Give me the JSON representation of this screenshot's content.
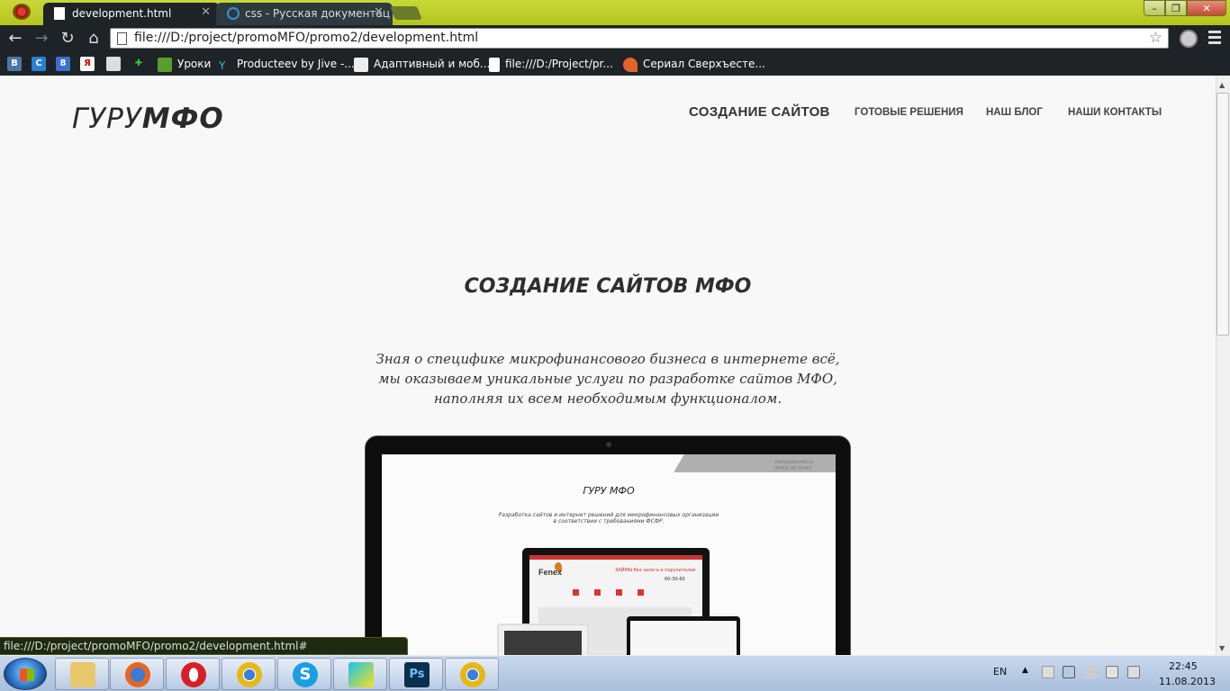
{
  "browser": {
    "tabs": [
      {
        "title": "development.html",
        "active": true
      },
      {
        "title": "css - Русская документац",
        "active": false
      }
    ],
    "address": "file:///D:/project/promoMFO/promo2/development.html",
    "bookmarks": [
      {
        "label": "Уроки",
        "icon": "3d-icon"
      },
      {
        "label": "Producteev by Jive -...",
        "icon": "producteev-icon"
      },
      {
        "label": "Адаптивный и моб...",
        "icon": "h-icon"
      },
      {
        "label": "file:///D:/Project/pr...",
        "icon": "file-icon"
      },
      {
        "label": "Сериал Сверхъесте...",
        "icon": "flame-icon"
      }
    ],
    "bookmark_shortcuts": [
      "В",
      "Я",
      "8"
    ],
    "status_url": "file:///D:/project/promoMFO/promo2/development.html#"
  },
  "site": {
    "logo_a": "ГУРУ",
    "logo_b": "МФО",
    "nav": [
      "СОЗДАНИЕ САЙТОВ",
      "ГОТОВЫЕ РЕШЕНИЯ",
      "НАШ БЛОГ",
      "НАШИ КОНТАКТЫ"
    ],
    "headline": "СОЗДАНИЕ САЙТОВ МФО",
    "lead": [
      "Зная о специфике микрофинансового бизнеса в интернете всё,",
      "мы оказываем уникальные услуги по разработке сайтов МФО,",
      "наполняя их всем необходимым функционалом."
    ],
    "mockup": {
      "contact_email": "mail@alterinfo.ru",
      "contact_phone": "(8452) 60-30-63",
      "logo": "ГУРУ МФО",
      "lead_1": "Разработка сайтов и интернет решений для микрофинансовых организации",
      "lead_2": "в соответствии с требованиями ФСФР.",
      "brand": "Fenex",
      "promo": "ЗАЙМЫ без залога и поручителей",
      "phone": "60-30-60"
    }
  },
  "taskbar": {
    "apps": [
      "explorer-icon",
      "firefox-icon",
      "opera-icon",
      "chrome-icon",
      "skype-icon",
      "webstorm-icon",
      "photoshop-icon",
      "chrome-icon"
    ],
    "lang": "EN",
    "time": "22:45",
    "date": "11.08.2013"
  },
  "colors": {
    "title_bar": "#b8c825",
    "chrome_dark": "#1d2326",
    "page_bg": "#f8f8f8",
    "text": "#2e2e2e"
  }
}
